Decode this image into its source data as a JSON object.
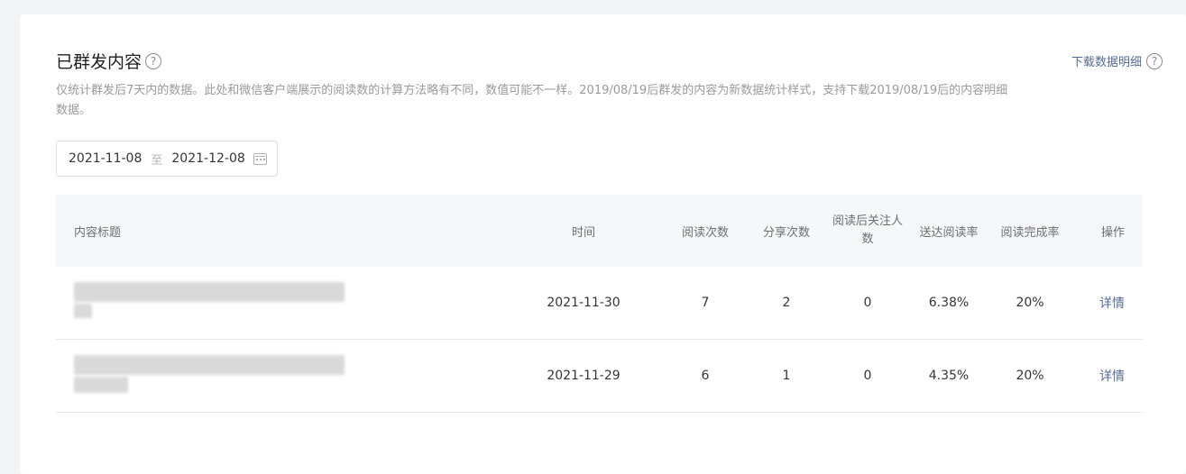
{
  "header": {
    "title": "已群发内容",
    "description": "仅统计群发后7天内的数据。此处和微信客户端展示的阅读数的计算方法略有不同，数值可能不一样。2019/08/19后群发的内容为新数据统计样式，支持下载2019/08/19后的内容明细数据。",
    "download_label": "下载数据明细",
    "help_glyph": "?"
  },
  "date_range": {
    "start": "2021-11-08",
    "separator": "至",
    "end": "2021-12-08"
  },
  "table": {
    "columns": {
      "title": "内容标题",
      "time": "时间",
      "reads": "阅读次数",
      "shares": "分享次数",
      "follows": "阅读后关注人数",
      "delivery_rate": "送达阅读率",
      "completion_rate": "阅读完成率",
      "action": "操作"
    },
    "rows": [
      {
        "time": "2021-11-30",
        "reads": "7",
        "shares": "2",
        "follows": "0",
        "delivery_rate": "6.38%",
        "completion_rate": "20%",
        "action": "详情"
      },
      {
        "time": "2021-11-29",
        "reads": "6",
        "shares": "1",
        "follows": "0",
        "delivery_rate": "4.35%",
        "completion_rate": "20%",
        "action": "详情"
      }
    ]
  },
  "colors": {
    "link": "#576b95",
    "muted_text": "#9a9a9a",
    "header_bg": "#f6f7f9"
  }
}
